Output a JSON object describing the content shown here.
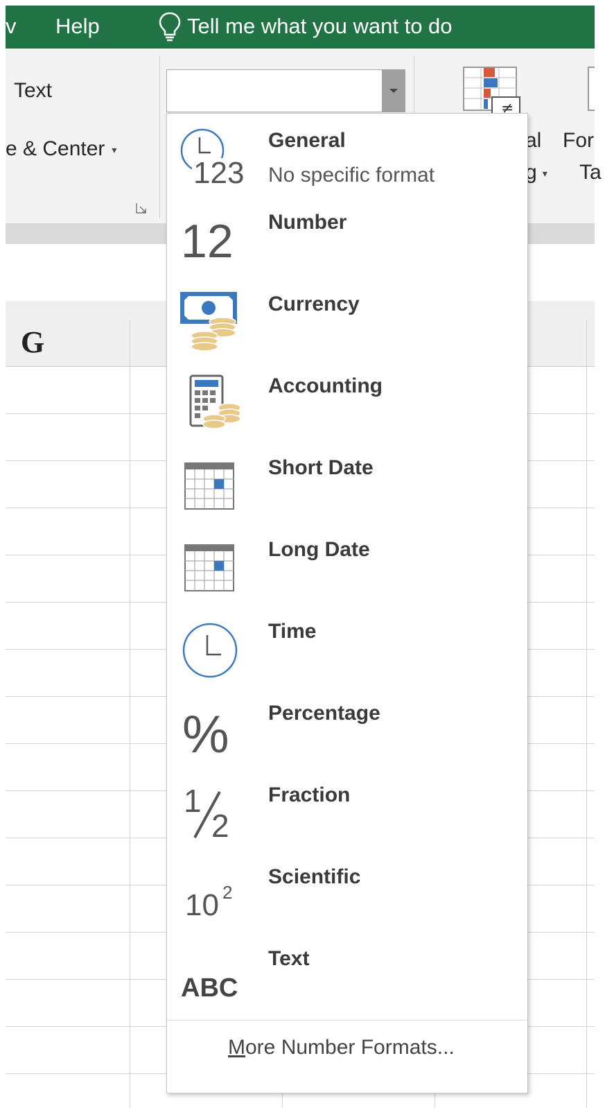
{
  "menu": {
    "fragment": "v",
    "help": "Help",
    "tell_me": "Tell me what you want to do",
    "tell_me_icon": "lightbulb-icon"
  },
  "ribbon": {
    "wrap_text_fragment": "Text",
    "merge_center_fragment": "e & Center",
    "conditional_fragment_top": "al",
    "conditional_fragment_bottom": "g",
    "format_fragment_top": "For",
    "format_fragment_bottom": "Ta",
    "number_format_value": ""
  },
  "sheet": {
    "column_header": "G"
  },
  "dropdown": {
    "items": [
      {
        "label": "General",
        "sub": "No specific format",
        "icon": "general-clock-123-icon"
      },
      {
        "label": "Number",
        "sub": "",
        "icon": "number-12-icon"
      },
      {
        "label": "Currency",
        "sub": "",
        "icon": "currency-bill-coins-icon"
      },
      {
        "label": "Accounting",
        "sub": "",
        "icon": "accounting-calculator-icon"
      },
      {
        "label": "Short Date",
        "sub": "",
        "icon": "calendar-icon"
      },
      {
        "label": "Long Date",
        "sub": "",
        "icon": "calendar-icon"
      },
      {
        "label": "Time",
        "sub": "",
        "icon": "clock-icon"
      },
      {
        "label": "Percentage",
        "sub": "",
        "icon": "percent-icon"
      },
      {
        "label": "Fraction",
        "sub": "",
        "icon": "fraction-icon"
      },
      {
        "label": "Scientific",
        "sub": "",
        "icon": "scientific-icon"
      },
      {
        "label": "Text",
        "sub": "",
        "icon": "text-abc-icon"
      }
    ],
    "glyphs": {
      "general": "123",
      "number": "12",
      "percent": "%",
      "fraction_num": "1",
      "fraction_den": "2",
      "sci_base": "10",
      "sci_exp": "2",
      "text_abc": "ABC"
    },
    "more": {
      "accel": "M",
      "rest": "ore Number Formats..."
    }
  },
  "colors": {
    "title_green": "#217346",
    "icon_blue": "#3c78be",
    "coin_gold": "#e9c98a",
    "bar_red": "#d9573b"
  }
}
